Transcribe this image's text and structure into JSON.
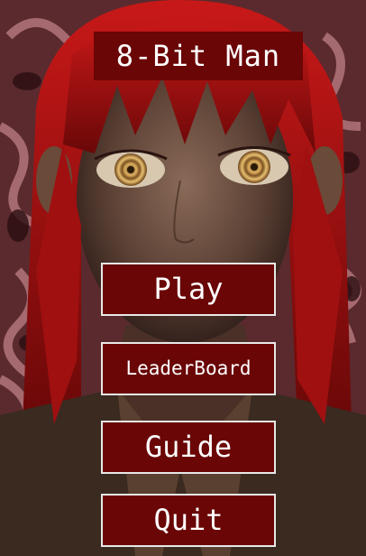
{
  "game": {
    "title": "8-Bit Man"
  },
  "menu": {
    "play": "Play",
    "leaderboard": "LeaderBoard",
    "guide": "Guide",
    "quit": "Quit"
  },
  "colors": {
    "button_bg": "#6a0606",
    "button_border": "#e8e8e8",
    "text": "#ffffff",
    "hair": "#b01010",
    "background_swirl": "#a8656a"
  }
}
